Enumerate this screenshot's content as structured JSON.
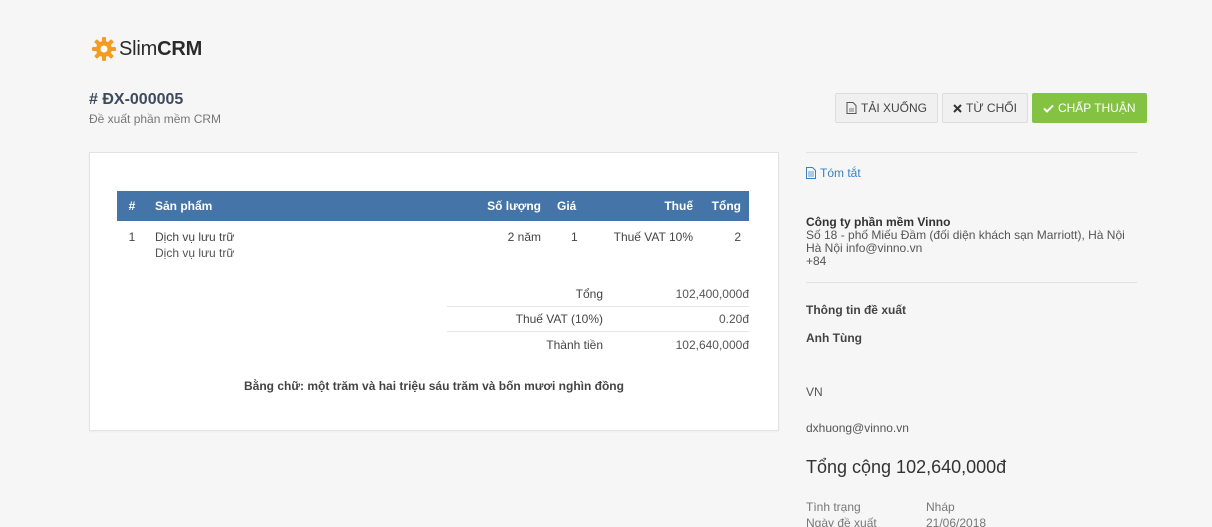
{
  "brand": {
    "prefix": "Slim",
    "suffix": "CRM"
  },
  "proposal": {
    "number": "# ĐX-000005",
    "subtitle": "Đề xuất phần mềm CRM"
  },
  "actions": {
    "download": "TẢI XUỐNG",
    "reject": "TỪ CHỐI",
    "approve": "CHẤP THUẬN"
  },
  "table": {
    "headers": [
      "#",
      "Sản phẩm",
      "Số lượng",
      "Giá",
      "Thuế",
      "Tổng"
    ],
    "rows": [
      {
        "no": "1",
        "product": "Dịch vụ lưu trữ",
        "description": "Dịch vụ lưu trữ",
        "qty": "2 năm",
        "price": "1",
        "tax": "Thuế VAT 10%",
        "total": "2"
      }
    ]
  },
  "totals": {
    "subtotal_label": "Tổng",
    "subtotal_value": "102,400,000đ",
    "tax_label": "Thuế VAT (10%)",
    "tax_value": "0.20đ",
    "grand_label": "Thành tiền",
    "grand_value": "102,640,000đ"
  },
  "in_words": "Bằng chữ: một trăm và hai triệu sáu trăm và bốn mươi nghìn đồng",
  "aside": {
    "summary_link": "Tóm tắt",
    "company_name": "Công ty phần mềm Vinno",
    "company_address": "Số 18 - phố Miếu Đầm (đối diện khách sạn Marriott), Hà Nội",
    "company_contact": "Hà Nội info@vinno.vn",
    "company_phone": "+84",
    "info_title": "Thông tin đề xuất",
    "person": "Anh Tùng",
    "country": "VN",
    "email": "dxhuong@vinno.vn",
    "total_big": "Tổng cộng 102,640,000đ",
    "status_label": "Tình trạng",
    "status_value": "Nháp",
    "date_label": "Ngày đề xuất",
    "date_value": "21/06/2018"
  },
  "colors": {
    "header": "#4474a8",
    "approve": "#84c341",
    "accent": "#3a7fc1",
    "logo": "#f39c1f"
  }
}
